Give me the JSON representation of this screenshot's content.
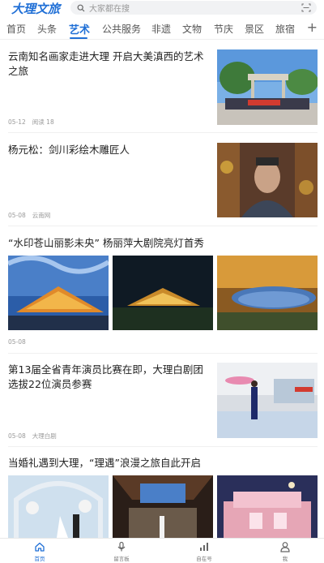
{
  "header": {
    "logo": "大理文旅",
    "search_placeholder": "大家都在搜"
  },
  "tabs": [
    {
      "label": "首页"
    },
    {
      "label": "头条"
    },
    {
      "label": "艺术"
    },
    {
      "label": "公共服务"
    },
    {
      "label": "非遗"
    },
    {
      "label": "文物"
    },
    {
      "label": "节庆"
    },
    {
      "label": "景区"
    },
    {
      "label": "旅宿"
    }
  ],
  "tabs_more": "+",
  "articles": [
    {
      "title": "云南知名画家走进大理 开启大美滇西的艺术之旅",
      "date": "05-12",
      "extra": "阅读 18"
    },
    {
      "title": "杨元松：剑川彩绘木雕匠人",
      "date": "05-08",
      "extra": "云南网"
    },
    {
      "title": "“水印苍山丽影未央” 杨丽萍大剧院亮灯首秀",
      "date": "05-08",
      "extra": ""
    },
    {
      "title": "第13届全省青年演员比赛在即，大理白剧团选拔22位演员参赛",
      "date": "05-08",
      "extra": "大理白剧"
    },
    {
      "title": "当婚礼遇到大理，“理遇”浪漫之旅自此开启",
      "date": "",
      "extra": ""
    }
  ],
  "bottom_nav": [
    {
      "label": "首页"
    },
    {
      "label": "留言板"
    },
    {
      "label": "自在号"
    },
    {
      "label": "我"
    }
  ],
  "colors": {
    "accent": "#1f6fd6",
    "text": "#222222",
    "meta": "#999999"
  }
}
